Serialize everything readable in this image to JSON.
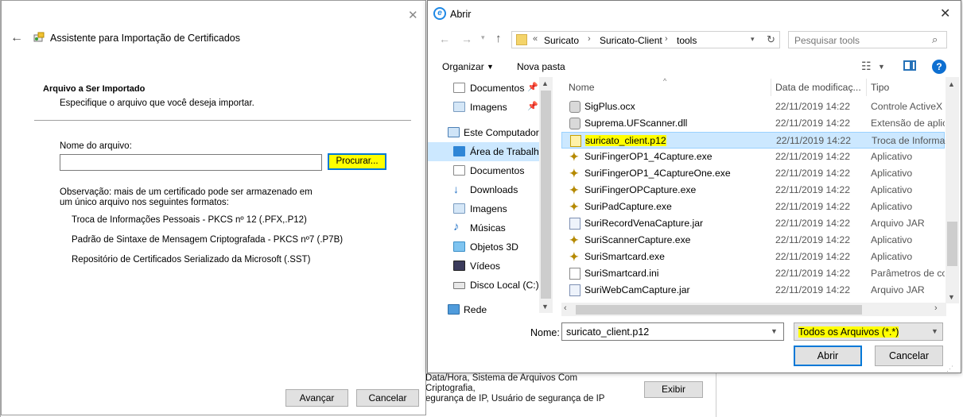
{
  "background": {
    "text_lines": [
      "Data/Hora, Sistema de Arquivos Com Criptografia,",
      "egurança de IP, Usuário de segurança de IP"
    ],
    "text_top": "...",
    "exibir_label": "Exibir"
  },
  "wizard": {
    "title": "Assistente para Importação de Certificados",
    "section_title": "Arquivo a Ser Importado",
    "section_subtitle": "Especifique o arquivo que você deseja importar.",
    "file_label": "Nome do arquivo:",
    "file_value": "",
    "browse_label": "Procurar...",
    "note": "Observação: mais de um certificado pode ser armazenado em um único arquivo nos seguintes formatos:",
    "formats": [
      "Troca de Informações Pessoais - PKCS nº 12 (.PFX,.P12)",
      "Padrão de Sintaxe de Mensagem Criptografada - PKCS nº7 (.P7B)",
      "Repositório de Certificados Serializado da Microsoft (.SST)"
    ],
    "next_label": "Avançar",
    "cancel_label": "Cancelar"
  },
  "dialog": {
    "title": "Abrir",
    "breadcrumb": [
      "Suricato",
      "Suricato-Client",
      "tools"
    ],
    "breadcrumb_prefix": "«",
    "search_placeholder": "Pesquisar tools",
    "organize_label": "Organizar",
    "new_folder_label": "Nova pasta",
    "tree": [
      {
        "label": "Documentos",
        "icon": "documents-icon",
        "pinned": true
      },
      {
        "label": "Imagens",
        "icon": "pictures-icon",
        "pinned": true
      },
      {
        "label": "Este Computador",
        "icon": "computer-icon"
      },
      {
        "label": "Área de Trabalho",
        "icon": "desktop-icon",
        "selected": true
      },
      {
        "label": "Documentos",
        "icon": "documents-icon"
      },
      {
        "label": "Downloads",
        "icon": "download-icon"
      },
      {
        "label": "Imagens",
        "icon": "pictures-icon"
      },
      {
        "label": "Músicas",
        "icon": "music-icon"
      },
      {
        "label": "Objetos 3D",
        "icon": "objects-3d-icon"
      },
      {
        "label": "Vídeos",
        "icon": "videos-icon"
      },
      {
        "label": "Disco Local (C:)",
        "icon": "drive-icon"
      },
      {
        "label": "Rede",
        "icon": "network-icon"
      }
    ],
    "columns": {
      "name": "Nome",
      "date": "Data de modificaç...",
      "type": "Tipo"
    },
    "files": [
      {
        "name": "SigPlus.ocx",
        "date": "22/11/2019 14:22",
        "type": "Controle ActiveX",
        "icon": "gear"
      },
      {
        "name": "Suprema.UFScanner.dll",
        "date": "22/11/2019 14:22",
        "type": "Extensão de aplica",
        "icon": "gear"
      },
      {
        "name": "suricato_client.p12",
        "date": "22/11/2019 14:22",
        "type": "Troca de Informaç",
        "icon": "cert",
        "selected": true
      },
      {
        "name": "SuriFingerOP1_4Capture.exe",
        "date": "22/11/2019 14:22",
        "type": "Aplicativo",
        "icon": "exe"
      },
      {
        "name": "SuriFingerOP1_4CaptureOne.exe",
        "date": "22/11/2019 14:22",
        "type": "Aplicativo",
        "icon": "exe"
      },
      {
        "name": "SuriFingerOPCapture.exe",
        "date": "22/11/2019 14:22",
        "type": "Aplicativo",
        "icon": "exe"
      },
      {
        "name": "SuriPadCapture.exe",
        "date": "22/11/2019 14:22",
        "type": "Aplicativo",
        "icon": "exe"
      },
      {
        "name": "SuriRecordVenaCapture.jar",
        "date": "22/11/2019 14:22",
        "type": "Arquivo JAR",
        "icon": "jar"
      },
      {
        "name": "SuriScannerCapture.exe",
        "date": "22/11/2019 14:22",
        "type": "Aplicativo",
        "icon": "exe"
      },
      {
        "name": "SuriSmartcard.exe",
        "date": "22/11/2019 14:22",
        "type": "Aplicativo",
        "icon": "exe"
      },
      {
        "name": "SuriSmartcard.ini",
        "date": "22/11/2019 14:22",
        "type": "Parâmetros de co",
        "icon": "ini"
      },
      {
        "name": "SuriWebCamCapture.jar",
        "date": "22/11/2019 14:22",
        "type": "Arquivo JAR",
        "icon": "jar"
      }
    ],
    "filename_label": "Nome:",
    "filename_value": "suricato_client.p12",
    "filetype_value": "Todos os Arquivos (*.*)",
    "open_label": "Abrir",
    "cancel_label": "Cancelar"
  }
}
